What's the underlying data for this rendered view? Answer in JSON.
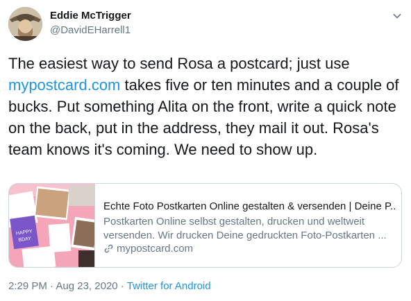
{
  "author": {
    "display_name": "Eddie McTrigger",
    "handle": "@DavidEHarrell1"
  },
  "tweet": {
    "text_before_link": "The easiest way to send Rosa a postcard; just use ",
    "link_text": "mypostcard.com",
    "text_after_link": " takes five or ten minutes and a couple of bucks.  Put something Alita on the front, write a quick note on the back, put in the address, they mail it out.  Rosa's team knows it's coming.  We need to show up."
  },
  "link_card": {
    "title": "Echte Foto Postkarten Online gestalten & versenden | Deine P...",
    "description": "Postkarten Online selbst gestalten, drucken und weltweit versenden. Wir drucken Deine gedruckten Foto-Postkarten ...",
    "domain": "mypostcard.com"
  },
  "meta": {
    "time": "2:29 PM",
    "separator": " · ",
    "date": "Aug 23, 2020",
    "source": "Twitter for Android"
  },
  "colors": {
    "link": "#1b95e0",
    "secondary_text": "#657786",
    "border": "#ccd6dd"
  },
  "icons": {
    "more": "chevron-down-icon",
    "card_domain": "link-icon"
  }
}
